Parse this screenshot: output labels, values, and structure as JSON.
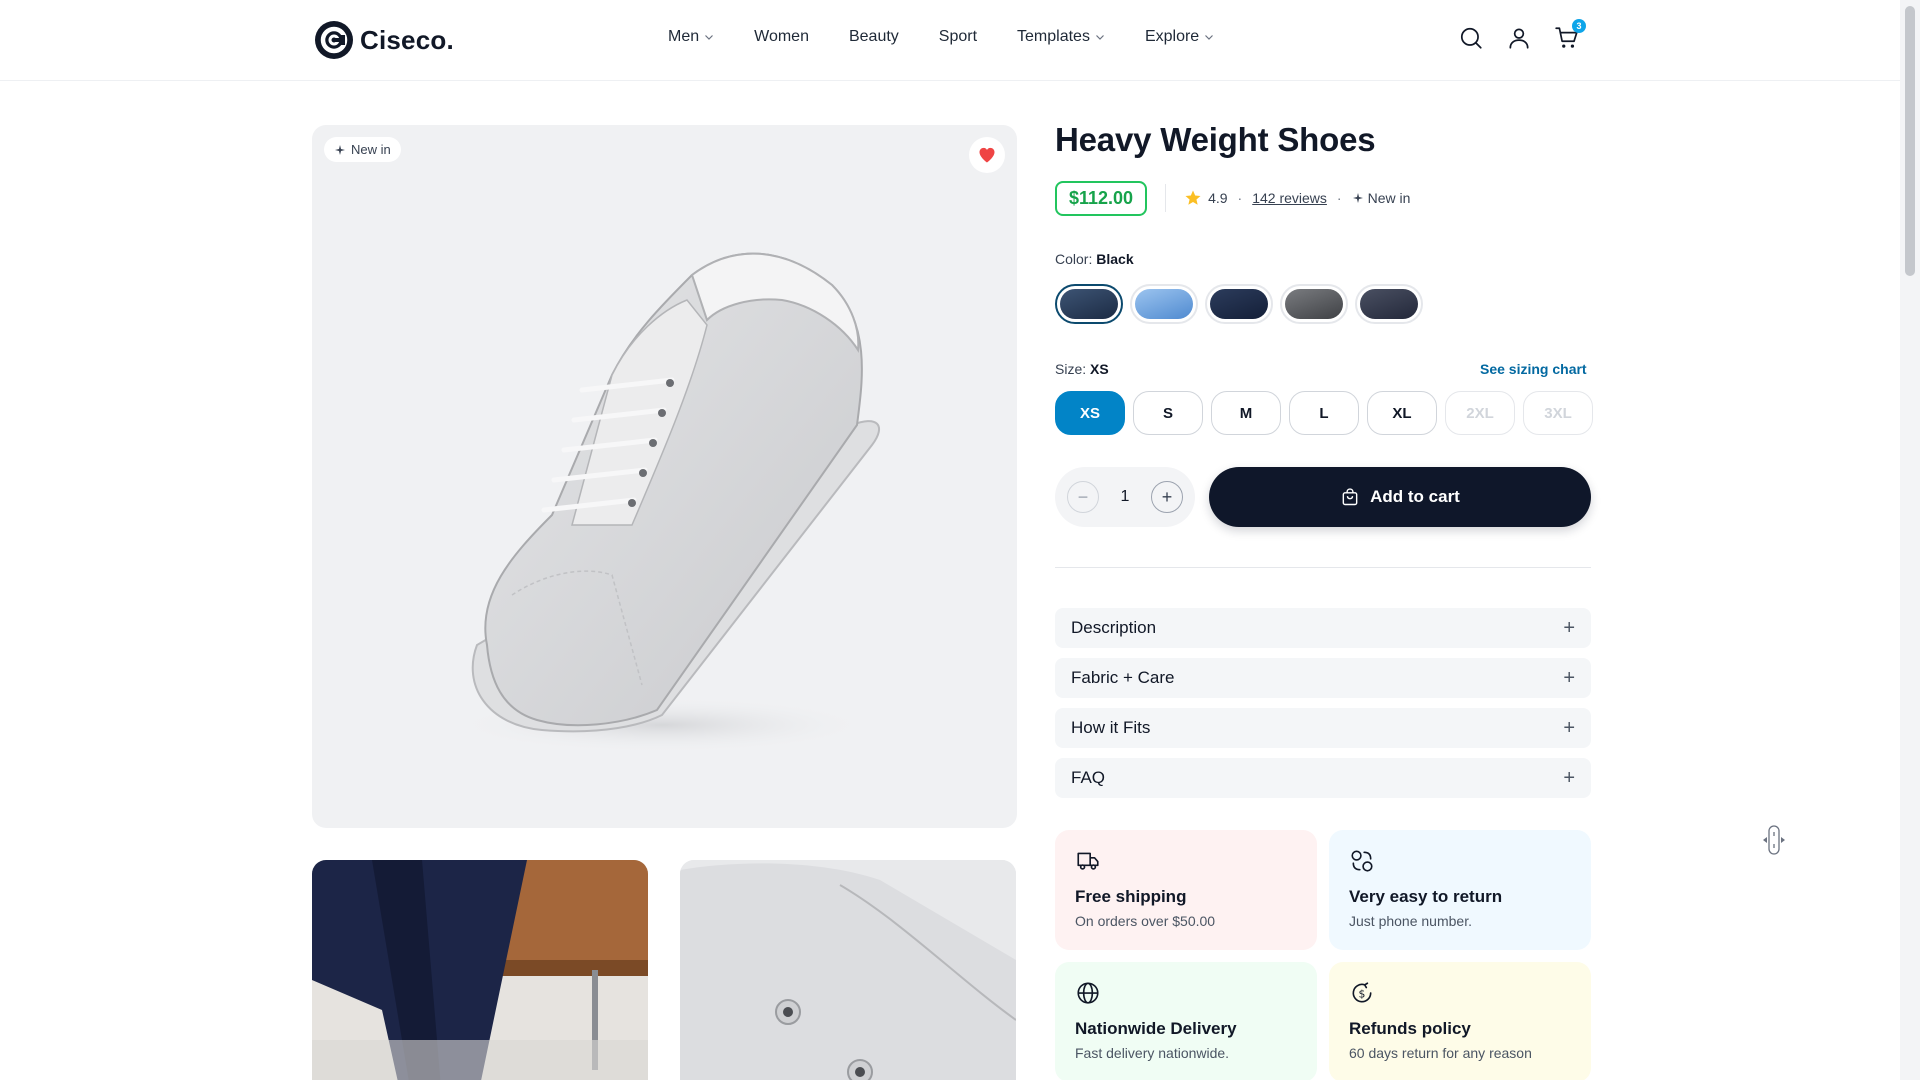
{
  "brand": {
    "name": "Ciseco."
  },
  "nav": {
    "items": [
      {
        "label": "Men",
        "dropdown": true
      },
      {
        "label": "Women",
        "dropdown": false
      },
      {
        "label": "Beauty",
        "dropdown": false
      },
      {
        "label": "Sport",
        "dropdown": false
      },
      {
        "label": "Templates",
        "dropdown": true
      },
      {
        "label": "Explore",
        "dropdown": true
      }
    ]
  },
  "header": {
    "cart_count": "3",
    "icons": [
      "search-icon",
      "user-icon",
      "cart-icon"
    ]
  },
  "gallery": {
    "badge": "New in"
  },
  "product": {
    "title": "Heavy Weight Shoes",
    "price": "$112.00",
    "rating": "4.9",
    "reviews": "142 reviews",
    "status": "New in"
  },
  "color": {
    "label": "Color:",
    "selected": "Black",
    "swatches": [
      "#2b3f5c",
      "#6aa3e0",
      "#1e2e4d",
      "#5a5c60",
      "#363b48"
    ]
  },
  "size": {
    "label": "Size:",
    "selected": "XS",
    "chart_link": "See sizing chart",
    "options": [
      "XS",
      "S",
      "M",
      "L",
      "XL",
      "2XL",
      "3XL"
    ],
    "disabled": [
      "2XL",
      "3XL"
    ]
  },
  "quantity": {
    "value": "1",
    "minus": "−",
    "plus": "+"
  },
  "cart_button": {
    "label": "Add to cart"
  },
  "accordion": [
    "Description",
    "Fabric + Care",
    "How it Fits",
    "FAQ"
  ],
  "policies": [
    {
      "title": "Free shipping",
      "desc": "On orders over $50.00",
      "icon": "truck-icon",
      "color": "#fef2f2"
    },
    {
      "title": "Very easy to return",
      "desc": "Just phone number.",
      "icon": "return-icon",
      "color": "#f0f9ff"
    },
    {
      "title": "Nationwide Delivery",
      "desc": "Fast delivery nationwide.",
      "icon": "globe-icon",
      "color": "#f0fdf4"
    },
    {
      "title": "Refunds policy",
      "desc": "60 days return for any reason",
      "icon": "refund-icon",
      "color": "#fefce8"
    }
  ]
}
